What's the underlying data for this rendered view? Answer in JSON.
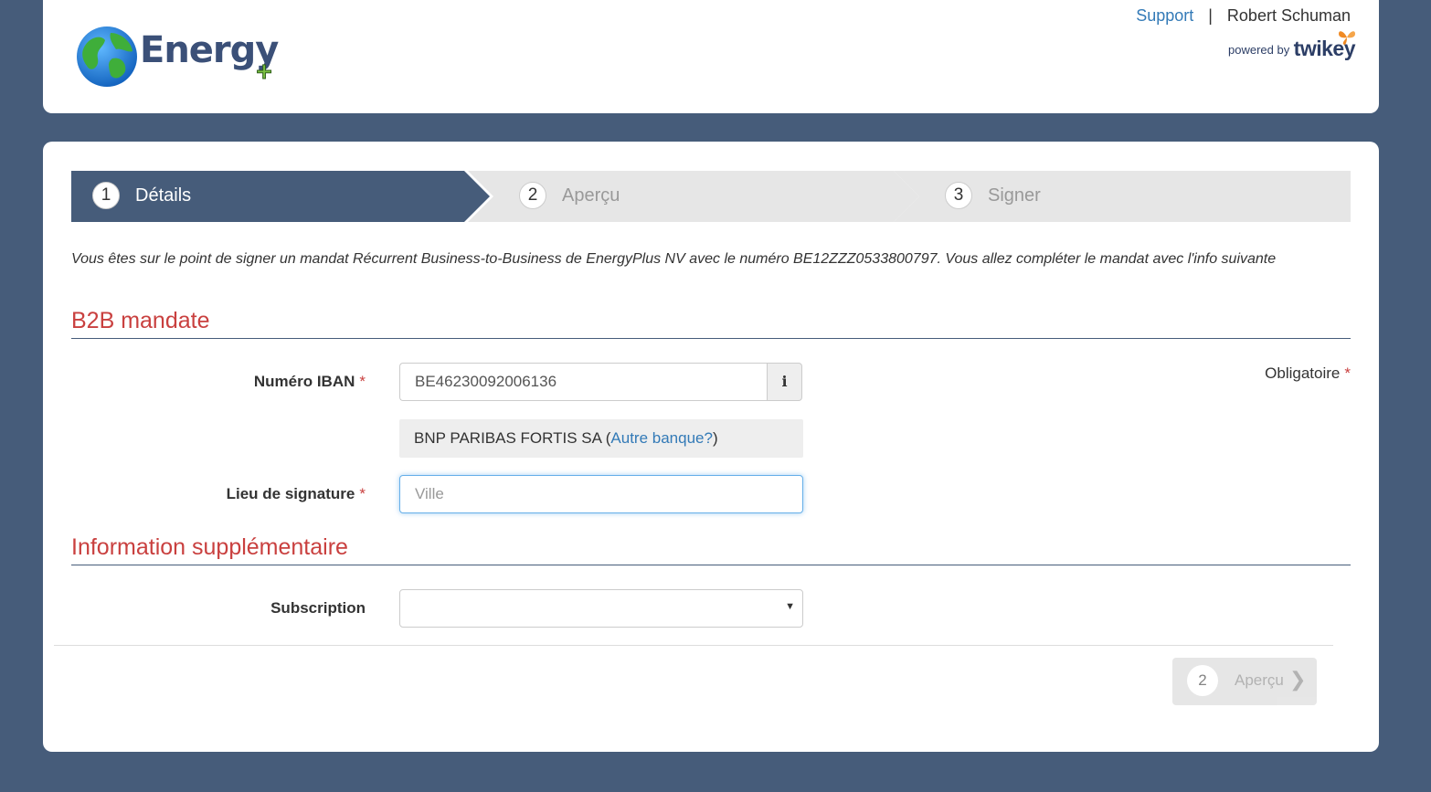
{
  "header": {
    "logo_text": "Energy",
    "logo_plus": "+",
    "support_link": "Support",
    "separator": "|",
    "user_name": "Robert Schuman",
    "powered_by_small": "powered by",
    "powered_by_brand": "twikey"
  },
  "stepper": {
    "steps": [
      {
        "num": "1",
        "label": "Détails",
        "state": "active"
      },
      {
        "num": "2",
        "label": "Aperçu",
        "state": "inactive"
      },
      {
        "num": "3",
        "label": "Signer",
        "state": "inactive"
      }
    ]
  },
  "intro_text": "Vous êtes sur le point de signer un mandat Récurrent Business-to-Business de EnergyPlus NV avec le numéro BE12ZZZ0533800797. Vous allez compléter le mandat avec l'info suivante",
  "section_b2b": {
    "title": "B2B mandate",
    "required_note": "Obligatoire",
    "required_star": "*",
    "iban": {
      "label": "Numéro IBAN",
      "value": "BE46230092006136",
      "info_icon_glyph": "i"
    },
    "bank": {
      "name": "BNP PARIBAS FORTIS SA (",
      "other_bank_link": "Autre banque?",
      "close_paren": ")"
    },
    "signature_place": {
      "label": "Lieu de signature",
      "placeholder": "Ville",
      "value": ""
    }
  },
  "section_extra": {
    "title": "Information supplémentaire",
    "subscription": {
      "label": "Subscription",
      "selected": ""
    }
  },
  "next_button": {
    "num": "2",
    "label": "Aperçu",
    "chevron": "❯"
  },
  "colors": {
    "background": "#465c7a",
    "accent_red": "#c9403f",
    "link_blue": "#337ab7",
    "active_step": "#465c7a",
    "inactive_step": "#e6e6e6"
  }
}
